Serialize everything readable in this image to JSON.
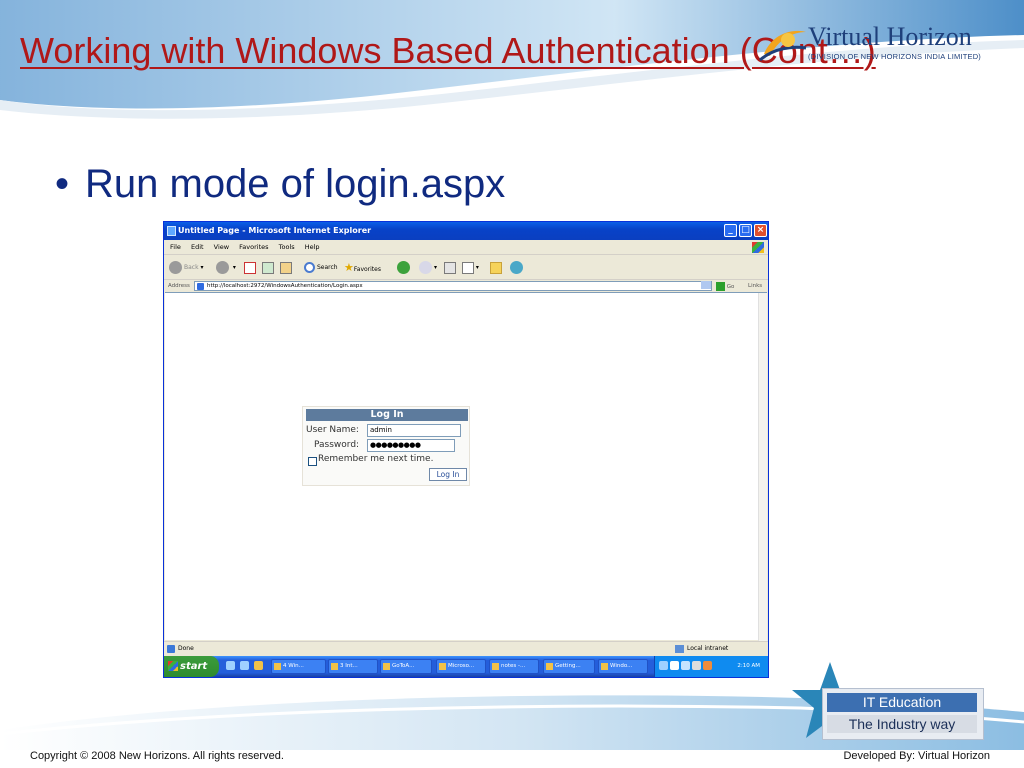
{
  "slide": {
    "title": "Working with Windows Based Authentication (Cont…)",
    "bullet": "Run mode of login.aspx",
    "footer_left": "Copyright © 2008 New Horizons. All rights reserved.",
    "footer_right": "Developed By: Virtual Horizon"
  },
  "logo": {
    "name": "Virtual Horizon",
    "subtitle": "(DIVISION OF NEW HORIZONS INDIA LIMITED)"
  },
  "badge": {
    "line1": "IT Education",
    "line2": "The Industry way"
  },
  "browser": {
    "window_title": "Untitled Page - Microsoft Internet Explorer",
    "menu": [
      "File",
      "Edit",
      "View",
      "Favorites",
      "Tools",
      "Help"
    ],
    "toolbar": {
      "back": "Back",
      "search": "Search",
      "favorites": "Favorites"
    },
    "address": {
      "label": "Address",
      "url": "http://localhost:2972/WindowsAuthentication/Login.aspx",
      "go": "Go",
      "links": "Links"
    },
    "status": {
      "text": "Done",
      "zone": "Local intranet"
    }
  },
  "login": {
    "header": "Log In",
    "username_label": "User Name:",
    "username_value": "admin",
    "password_label": "Password:",
    "password_value": "●●●●●●●●●",
    "remember_label": "Remember me next time.",
    "button": "Log In"
  },
  "taskbar": {
    "start": "start",
    "buttons": [
      "4 Win...",
      "3 Int...",
      "GoToA...",
      "Microso...",
      "notes -...",
      "Getting...",
      "Windo..."
    ],
    "clock": "2:10 AM"
  },
  "colors": {
    "title": "#b01818",
    "bullet": "#102a80",
    "login_header": "#5d7b9d",
    "xp_titlebar": "#0842c8"
  }
}
